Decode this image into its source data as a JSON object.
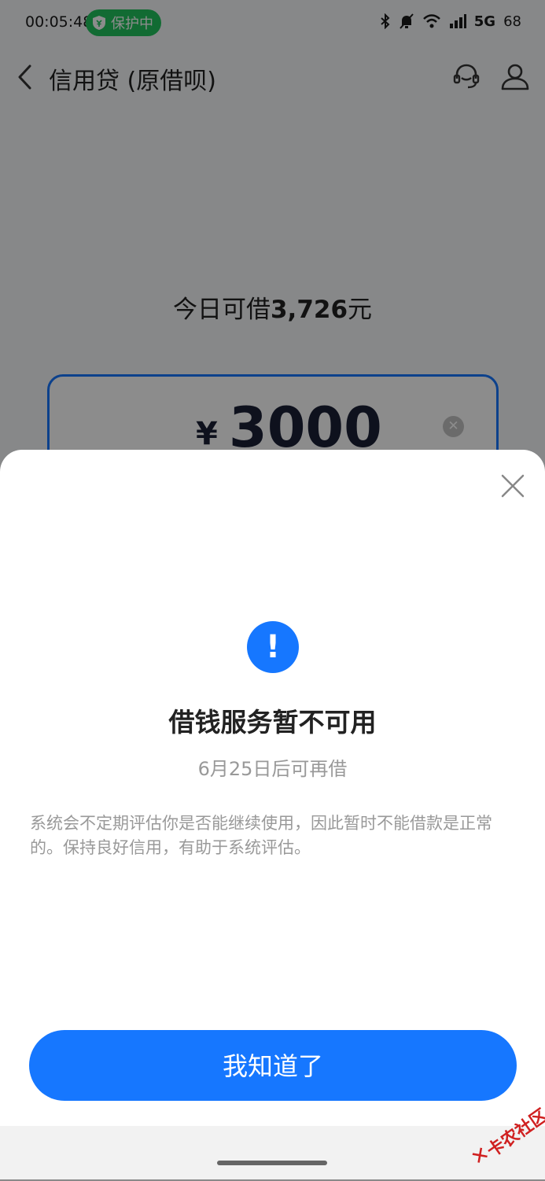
{
  "status_bar": {
    "time": "00:05:48",
    "protect_label": "保护中",
    "network": "5G",
    "battery": "68"
  },
  "nav": {
    "title": "信用贷 (原借呗)"
  },
  "loan": {
    "available_prefix": "今日可借",
    "available_amount": "3,726",
    "available_suffix": "元",
    "currency_symbol": "¥",
    "amount_input_value": "3000"
  },
  "dialog": {
    "title": "借钱服务暂不可用",
    "subtitle": "6月25日后可再借",
    "description": "系统会不定期评估你是否能继续使用，因此暂时不能借款是正常的。保持良好信用，有助于系统评估。",
    "confirm_label": "我知道了",
    "alert_symbol": "!"
  },
  "watermark": {
    "text": "卡农社区"
  },
  "colors": {
    "primary": "#1677ff",
    "protect_green": "#22c35e"
  }
}
